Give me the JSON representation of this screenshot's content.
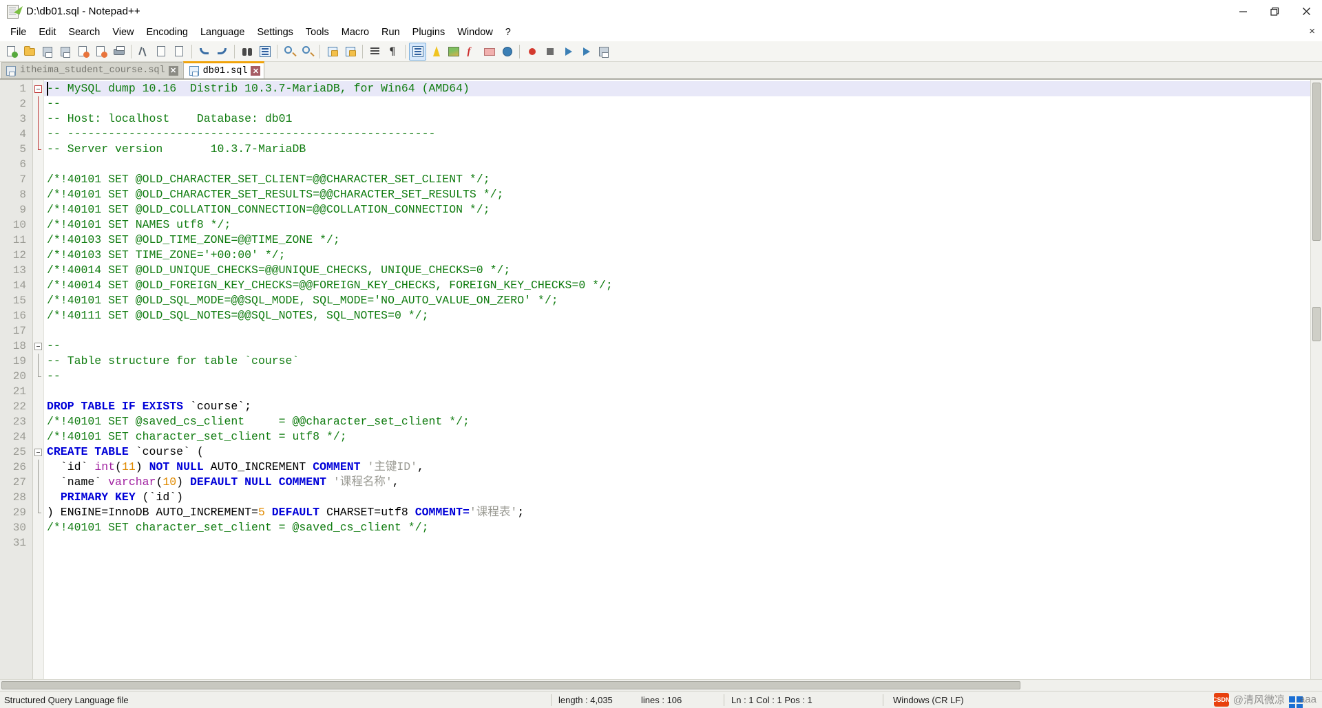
{
  "window": {
    "title": "D:\\db01.sql - Notepad++",
    "app_icon": "notepad-plus-plus-icon",
    "minimize_label": "Minimize",
    "maximize_label": "Restore",
    "close_label": "Close"
  },
  "menubar": {
    "items": [
      {
        "label": "File"
      },
      {
        "label": "Edit"
      },
      {
        "label": "Search"
      },
      {
        "label": "View"
      },
      {
        "label": "Encoding"
      },
      {
        "label": "Language"
      },
      {
        "label": "Settings"
      },
      {
        "label": "Tools"
      },
      {
        "label": "Macro"
      },
      {
        "label": "Run"
      },
      {
        "label": "Plugins"
      },
      {
        "label": "Window"
      },
      {
        "label": "?"
      }
    ],
    "close_document_label": "×"
  },
  "toolbar": {
    "buttons": [
      {
        "name": "new-file-icon",
        "title": "New"
      },
      {
        "name": "open-file-icon",
        "title": "Open"
      },
      {
        "name": "save-icon",
        "title": "Save"
      },
      {
        "name": "save-all-icon",
        "title": "Save All"
      },
      {
        "name": "close-file-icon",
        "title": "Close"
      },
      {
        "name": "close-all-icon",
        "title": "Close All"
      },
      {
        "name": "print-icon",
        "title": "Print"
      },
      {
        "name": "cut-icon",
        "title": "Cut"
      },
      {
        "name": "copy-icon",
        "title": "Copy"
      },
      {
        "name": "paste-icon",
        "title": "Paste"
      },
      {
        "name": "undo-icon",
        "title": "Undo"
      },
      {
        "name": "redo-icon",
        "title": "Redo"
      },
      {
        "name": "find-icon",
        "title": "Find"
      },
      {
        "name": "replace-icon",
        "title": "Replace"
      },
      {
        "name": "zoom-in-icon",
        "title": "Zoom In"
      },
      {
        "name": "zoom-out-icon",
        "title": "Zoom Out"
      },
      {
        "name": "sync-vertical-icon",
        "title": "Synchronize Vertical Scrolling"
      },
      {
        "name": "sync-horizontal-icon",
        "title": "Synchronize Horizontal Scrolling"
      },
      {
        "name": "word-wrap-icon",
        "title": "Word Wrap"
      },
      {
        "name": "show-all-characters-icon",
        "title": "Show All Characters"
      },
      {
        "name": "indent-guide-icon",
        "title": "Show Indent Guide"
      },
      {
        "name": "user-defined-language-icon",
        "title": "User-Defined Dialogue"
      },
      {
        "name": "document-map-icon",
        "title": "Document Map"
      },
      {
        "name": "function-list-icon",
        "title": "Function List"
      },
      {
        "name": "folder-workspace-icon",
        "title": "Folder as Workspace"
      },
      {
        "name": "monitoring-icon",
        "title": "Monitoring"
      },
      {
        "name": "macro-record-icon",
        "title": "Start Recording"
      },
      {
        "name": "macro-stop-icon",
        "title": "Stop Recording"
      },
      {
        "name": "macro-play-icon",
        "title": "Playback"
      },
      {
        "name": "macro-run-multiple-icon",
        "title": "Run a Macro Multiple Times"
      },
      {
        "name": "macro-save-icon",
        "title": "Save Current Recorded Macro"
      }
    ]
  },
  "tabs": [
    {
      "label": "itheima_student_course.sql",
      "active": false,
      "close_label": "✕",
      "icon": "saved-file-icon"
    },
    {
      "label": "db01.sql",
      "active": true,
      "close_label": "✕",
      "icon": "saved-file-icon"
    }
  ],
  "editor": {
    "current_line": 1,
    "lines": [
      {
        "n": 1,
        "fold": "start-red",
        "tokens": [
          {
            "t": "-- MySQL dump 10.16  Distrib 10.3.7-MariaDB, for Win64 (AMD64)",
            "c": "cm"
          }
        ]
      },
      {
        "n": 2,
        "fold": "bar-red",
        "tokens": [
          {
            "t": "--",
            "c": "cm"
          }
        ]
      },
      {
        "n": 3,
        "fold": "bar-red",
        "tokens": [
          {
            "t": "-- Host: localhost    Database: db01",
            "c": "cm"
          }
        ]
      },
      {
        "n": 4,
        "fold": "bar-red",
        "tokens": [
          {
            "t": "-- ------------------------------------------------------",
            "c": "cm"
          }
        ]
      },
      {
        "n": 5,
        "fold": "end-red",
        "tokens": [
          {
            "t": "-- Server version\t10.3.7-MariaDB",
            "c": "cm"
          }
        ]
      },
      {
        "n": 6,
        "fold": "",
        "tokens": [
          {
            "t": "",
            "c": "pl"
          }
        ]
      },
      {
        "n": 7,
        "fold": "",
        "tokens": [
          {
            "t": "/*!40101 SET @OLD_CHARACTER_SET_CLIENT=@@CHARACTER_SET_CLIENT */;",
            "c": "cm"
          }
        ]
      },
      {
        "n": 8,
        "fold": "",
        "tokens": [
          {
            "t": "/*!40101 SET @OLD_CHARACTER_SET_RESULTS=@@CHARACTER_SET_RESULTS */;",
            "c": "cm"
          }
        ]
      },
      {
        "n": 9,
        "fold": "",
        "tokens": [
          {
            "t": "/*!40101 SET @OLD_COLLATION_CONNECTION=@@COLLATION_CONNECTION */;",
            "c": "cm"
          }
        ]
      },
      {
        "n": 10,
        "fold": "",
        "tokens": [
          {
            "t": "/*!40101 SET NAMES utf8 */;",
            "c": "cm"
          }
        ]
      },
      {
        "n": 11,
        "fold": "",
        "tokens": [
          {
            "t": "/*!40103 SET @OLD_TIME_ZONE=@@TIME_ZONE */;",
            "c": "cm"
          }
        ]
      },
      {
        "n": 12,
        "fold": "",
        "tokens": [
          {
            "t": "/*!40103 SET TIME_ZONE='+00:00' */;",
            "c": "cm"
          }
        ]
      },
      {
        "n": 13,
        "fold": "",
        "tokens": [
          {
            "t": "/*!40014 SET @OLD_UNIQUE_CHECKS=@@UNIQUE_CHECKS, UNIQUE_CHECKS=0 */;",
            "c": "cm"
          }
        ]
      },
      {
        "n": 14,
        "fold": "",
        "tokens": [
          {
            "t": "/*!40014 SET @OLD_FOREIGN_KEY_CHECKS=@@FOREIGN_KEY_CHECKS, FOREIGN_KEY_CHECKS=0 */;",
            "c": "cm"
          }
        ]
      },
      {
        "n": 15,
        "fold": "",
        "tokens": [
          {
            "t": "/*!40101 SET @OLD_SQL_MODE=@@SQL_MODE, SQL_MODE='NO_AUTO_VALUE_ON_ZERO' */;",
            "c": "cm"
          }
        ]
      },
      {
        "n": 16,
        "fold": "",
        "tokens": [
          {
            "t": "/*!40111 SET @OLD_SQL_NOTES=@@SQL_NOTES, SQL_NOTES=0 */;",
            "c": "cm"
          }
        ]
      },
      {
        "n": 17,
        "fold": "",
        "tokens": [
          {
            "t": "",
            "c": "pl"
          }
        ]
      },
      {
        "n": 18,
        "fold": "start-gray",
        "tokens": [
          {
            "t": "--",
            "c": "cm"
          }
        ]
      },
      {
        "n": 19,
        "fold": "bar-gray",
        "tokens": [
          {
            "t": "-- Table structure for table `course`",
            "c": "cm"
          }
        ]
      },
      {
        "n": 20,
        "fold": "end-gray",
        "tokens": [
          {
            "t": "--",
            "c": "cm"
          }
        ]
      },
      {
        "n": 21,
        "fold": "",
        "tokens": [
          {
            "t": "",
            "c": "pl"
          }
        ]
      },
      {
        "n": 22,
        "fold": "",
        "tokens": [
          {
            "t": "DROP TABLE IF EXISTS",
            "c": "kw"
          },
          {
            "t": " `course`;",
            "c": "pl"
          }
        ]
      },
      {
        "n": 23,
        "fold": "",
        "tokens": [
          {
            "t": "/*!40101 SET @saved_cs_client     = @@character_set_client */;",
            "c": "cm"
          }
        ]
      },
      {
        "n": 24,
        "fold": "",
        "tokens": [
          {
            "t": "/*!40101 SET character_set_client = utf8 */;",
            "c": "cm"
          }
        ]
      },
      {
        "n": 25,
        "fold": "start-gray",
        "tokens": [
          {
            "t": "CREATE TABLE",
            "c": "kw"
          },
          {
            "t": " `course` (",
            "c": "pl"
          }
        ]
      },
      {
        "n": 26,
        "fold": "bar-gray",
        "tokens": [
          {
            "t": "  `id` ",
            "c": "pl"
          },
          {
            "t": "int",
            "c": "typ"
          },
          {
            "t": "(",
            "c": "pl"
          },
          {
            "t": "11",
            "c": "num"
          },
          {
            "t": ") ",
            "c": "pl"
          },
          {
            "t": "NOT NULL",
            "c": "kw"
          },
          {
            "t": " AUTO_INCREMENT ",
            "c": "pl"
          },
          {
            "t": "COMMENT",
            "c": "kw"
          },
          {
            "t": " ",
            "c": "pl"
          },
          {
            "t": "'主键ID'",
            "c": "str"
          },
          {
            "t": ",",
            "c": "pl"
          }
        ]
      },
      {
        "n": 27,
        "fold": "bar-gray",
        "tokens": [
          {
            "t": "  `name` ",
            "c": "pl"
          },
          {
            "t": "varchar",
            "c": "typ"
          },
          {
            "t": "(",
            "c": "pl"
          },
          {
            "t": "10",
            "c": "num"
          },
          {
            "t": ") ",
            "c": "pl"
          },
          {
            "t": "DEFAULT NULL COMMENT",
            "c": "kw"
          },
          {
            "t": " ",
            "c": "pl"
          },
          {
            "t": "'课程名称'",
            "c": "str"
          },
          {
            "t": ",",
            "c": "pl"
          }
        ]
      },
      {
        "n": 28,
        "fold": "bar-gray",
        "tokens": [
          {
            "t": "  ",
            "c": "pl"
          },
          {
            "t": "PRIMARY KEY",
            "c": "kw"
          },
          {
            "t": " (`id`)",
            "c": "pl"
          }
        ]
      },
      {
        "n": 29,
        "fold": "end-gray",
        "tokens": [
          {
            "t": ") ENGINE=InnoDB AUTO_INCREMENT=",
            "c": "pl"
          },
          {
            "t": "5",
            "c": "num"
          },
          {
            "t": " ",
            "c": "pl"
          },
          {
            "t": "DEFAULT",
            "c": "kw"
          },
          {
            "t": " CHARSET=utf8 ",
            "c": "pl"
          },
          {
            "t": "COMMENT=",
            "c": "kw"
          },
          {
            "t": "'课程表'",
            "c": "str"
          },
          {
            "t": ";",
            "c": "pl"
          }
        ]
      },
      {
        "n": 30,
        "fold": "",
        "tokens": [
          {
            "t": "/*!40101 SET character_set_client = @saved_cs_client */;",
            "c": "cm"
          }
        ]
      },
      {
        "n": 31,
        "fold": "",
        "tokens": [
          {
            "t": "",
            "c": "pl"
          }
        ]
      }
    ]
  },
  "statusbar": {
    "doc_type": "Structured Query Language file",
    "length": "length : 4,035",
    "lines": "lines : 106",
    "position": "Ln : 1   Col : 1   Pos : 1",
    "eol": "Windows (CR LF)"
  },
  "watermark": {
    "brand": "CSDN",
    "handle": "@清风微凉",
    "suffix": "aaa"
  },
  "colors": {
    "comment": "#107c10",
    "keyword": "#0000d8",
    "datatype": "#a020a0",
    "number": "#e08a00",
    "string": "#9a9a93",
    "current_line_bg": "#e8e8f8",
    "active_tab_accent": "#f0a30a"
  }
}
